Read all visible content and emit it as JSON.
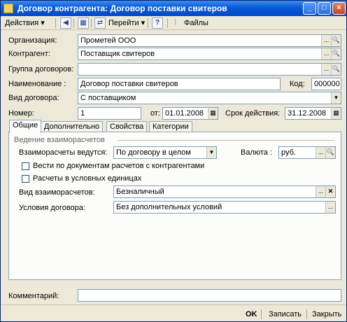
{
  "window": {
    "title": "Договор контрагента: Договор поставки свитеров",
    "controls": {
      "minimize": "_",
      "maximize": "□",
      "close": "×"
    }
  },
  "toolbar": {
    "actions": "Действия",
    "goto": "Перейти",
    "help": "?",
    "files": "Файлы"
  },
  "form": {
    "organization": {
      "label": "Организация:",
      "value": "Прометей ООО"
    },
    "counterparty": {
      "label": "Контрагент:",
      "value": "Поставщик свитеров"
    },
    "contract_group": {
      "label": "Группа договоров:",
      "value": ""
    },
    "name": {
      "label": "Наименование :",
      "value": "Договор поставки свитеров"
    },
    "code": {
      "label": "Код:",
      "value": "000000"
    },
    "contract_type": {
      "label": "Вид договора:",
      "value": "С поставщиком"
    },
    "number": {
      "label": "Номер:",
      "value": "1"
    },
    "from": {
      "label": "от:",
      "value": "01.01.2008"
    },
    "validity": {
      "label": "Срок действия:",
      "value": "31.12.2008"
    }
  },
  "tabs": [
    "Общие",
    "Дополнительно",
    "Свойства",
    "Категории"
  ],
  "general": {
    "section_title": "Ведение взаиморасчетов",
    "settlements_label": "Взаиморасчеты ведутся:",
    "settlements_value": "По договору в целом",
    "currency_label": "Валюта :",
    "currency_value": "руб.",
    "check_docs_label": "Вести по документам расчетов с контрагентами",
    "check_conditional_label": "Расчеты в условных единицах",
    "payment_type_label": "Вид взаиморасчетов:",
    "payment_type_value": "Безналичный",
    "conditions_label": "Условия договора:",
    "conditions_value": "Без дополнительных условий"
  },
  "comment": {
    "label": "Комментарий:",
    "value": ""
  },
  "buttons": {
    "ok": "OK",
    "save": "Записать",
    "close": "Закрыть"
  }
}
